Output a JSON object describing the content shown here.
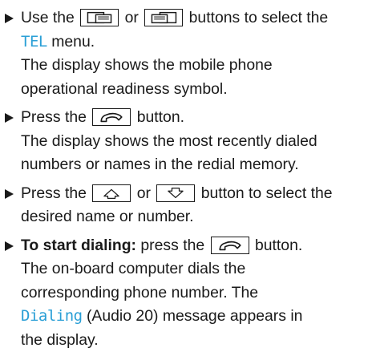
{
  "steps": [
    {
      "segments": {
        "a": "Use the",
        "b": "or",
        "c": "buttons to select the",
        "menu": "TEL",
        "d": "menu.",
        "result": "The display shows the mobile phone",
        "result2": "operational readiness symbol."
      },
      "icons": [
        "page-back-icon",
        "page-forward-icon"
      ]
    },
    {
      "segments": {
        "a": "Press the",
        "b": "button.",
        "result": "The display shows the most recently dialed",
        "result2": "numbers or names in the redial memory."
      },
      "icons": [
        "phone-handset-icon"
      ]
    },
    {
      "segments": {
        "a": "Press the",
        "b": "or",
        "c": "button to select the",
        "d": "desired name or number."
      },
      "icons": [
        "arrow-up-icon",
        "arrow-down-icon"
      ]
    },
    {
      "segments": {
        "lead": "To start dialing:",
        "a": "press the",
        "b": "button.",
        "result": "The on-board computer dials the",
        "result2": "corresponding phone number. The",
        "display_msg": "Dialing",
        "result3": "(Audio 20) message appears in",
        "result4": "the display."
      },
      "icons": [
        "phone-handset-icon"
      ]
    }
  ]
}
